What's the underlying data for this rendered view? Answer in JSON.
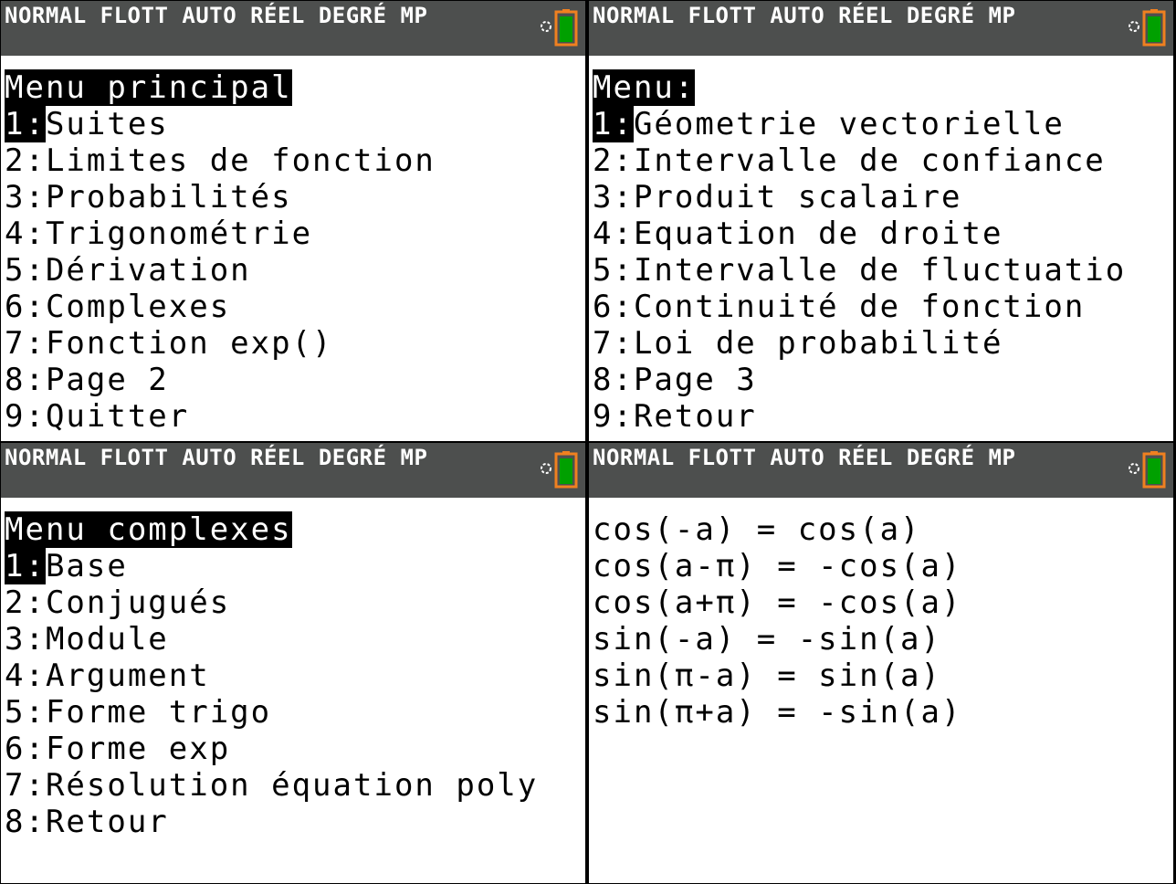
{
  "status_bar": {
    "text": "NORMAL FLOTT AUTO RÉEL DEGRÉ MP"
  },
  "colors": {
    "status_bg": "#4d4f4e",
    "battery_outline": "#f08020",
    "battery_fill": "#00a000"
  },
  "screens": [
    {
      "title": "Menu principal",
      "items": [
        {
          "num": "1:",
          "label": "Suites"
        },
        {
          "num": "2:",
          "label": "Limites de fonction"
        },
        {
          "num": "3:",
          "label": "Probabilités"
        },
        {
          "num": "4:",
          "label": "Trigonométrie"
        },
        {
          "num": "5:",
          "label": "Dérivation"
        },
        {
          "num": "6:",
          "label": "Complexes"
        },
        {
          "num": "7:",
          "label": "Fonction exp()"
        },
        {
          "num": "8:",
          "label": "Page 2"
        },
        {
          "num": "9:",
          "label": "Quitter"
        }
      ]
    },
    {
      "title": "Menu:",
      "items": [
        {
          "num": "1:",
          "label": "Géometrie vectorielle"
        },
        {
          "num": "2:",
          "label": "Intervalle de confiance"
        },
        {
          "num": "3:",
          "label": "Produit scalaire"
        },
        {
          "num": "4:",
          "label": "Equation de droite"
        },
        {
          "num": "5:",
          "label": "Intervalle de fluctuatio"
        },
        {
          "num": "6:",
          "label": "Continuité de fonction"
        },
        {
          "num": "7:",
          "label": "Loi de probabilité"
        },
        {
          "num": "8:",
          "label": "Page 3"
        },
        {
          "num": "9:",
          "label": "Retour"
        }
      ]
    },
    {
      "title": "Menu complexes",
      "items": [
        {
          "num": "1:",
          "label": "Base"
        },
        {
          "num": "2:",
          "label": "Conjugués"
        },
        {
          "num": "3:",
          "label": "Module"
        },
        {
          "num": "4:",
          "label": "Argument"
        },
        {
          "num": "5:",
          "label": "Forme trigo"
        },
        {
          "num": "6:",
          "label": "Forme exp"
        },
        {
          "num": "7:",
          "label": "Résolution équation poly"
        },
        {
          "num": "8:",
          "label": "Retour"
        }
      ]
    },
    {
      "lines": [
        "cos(-a) = cos(a)",
        "cos(a-π) = -cos(a)",
        "cos(a+π) = -cos(a)",
        "sin(-a) = -sin(a)",
        "sin(π-a) = sin(a)",
        "sin(π+a) = -sin(a)"
      ]
    }
  ]
}
